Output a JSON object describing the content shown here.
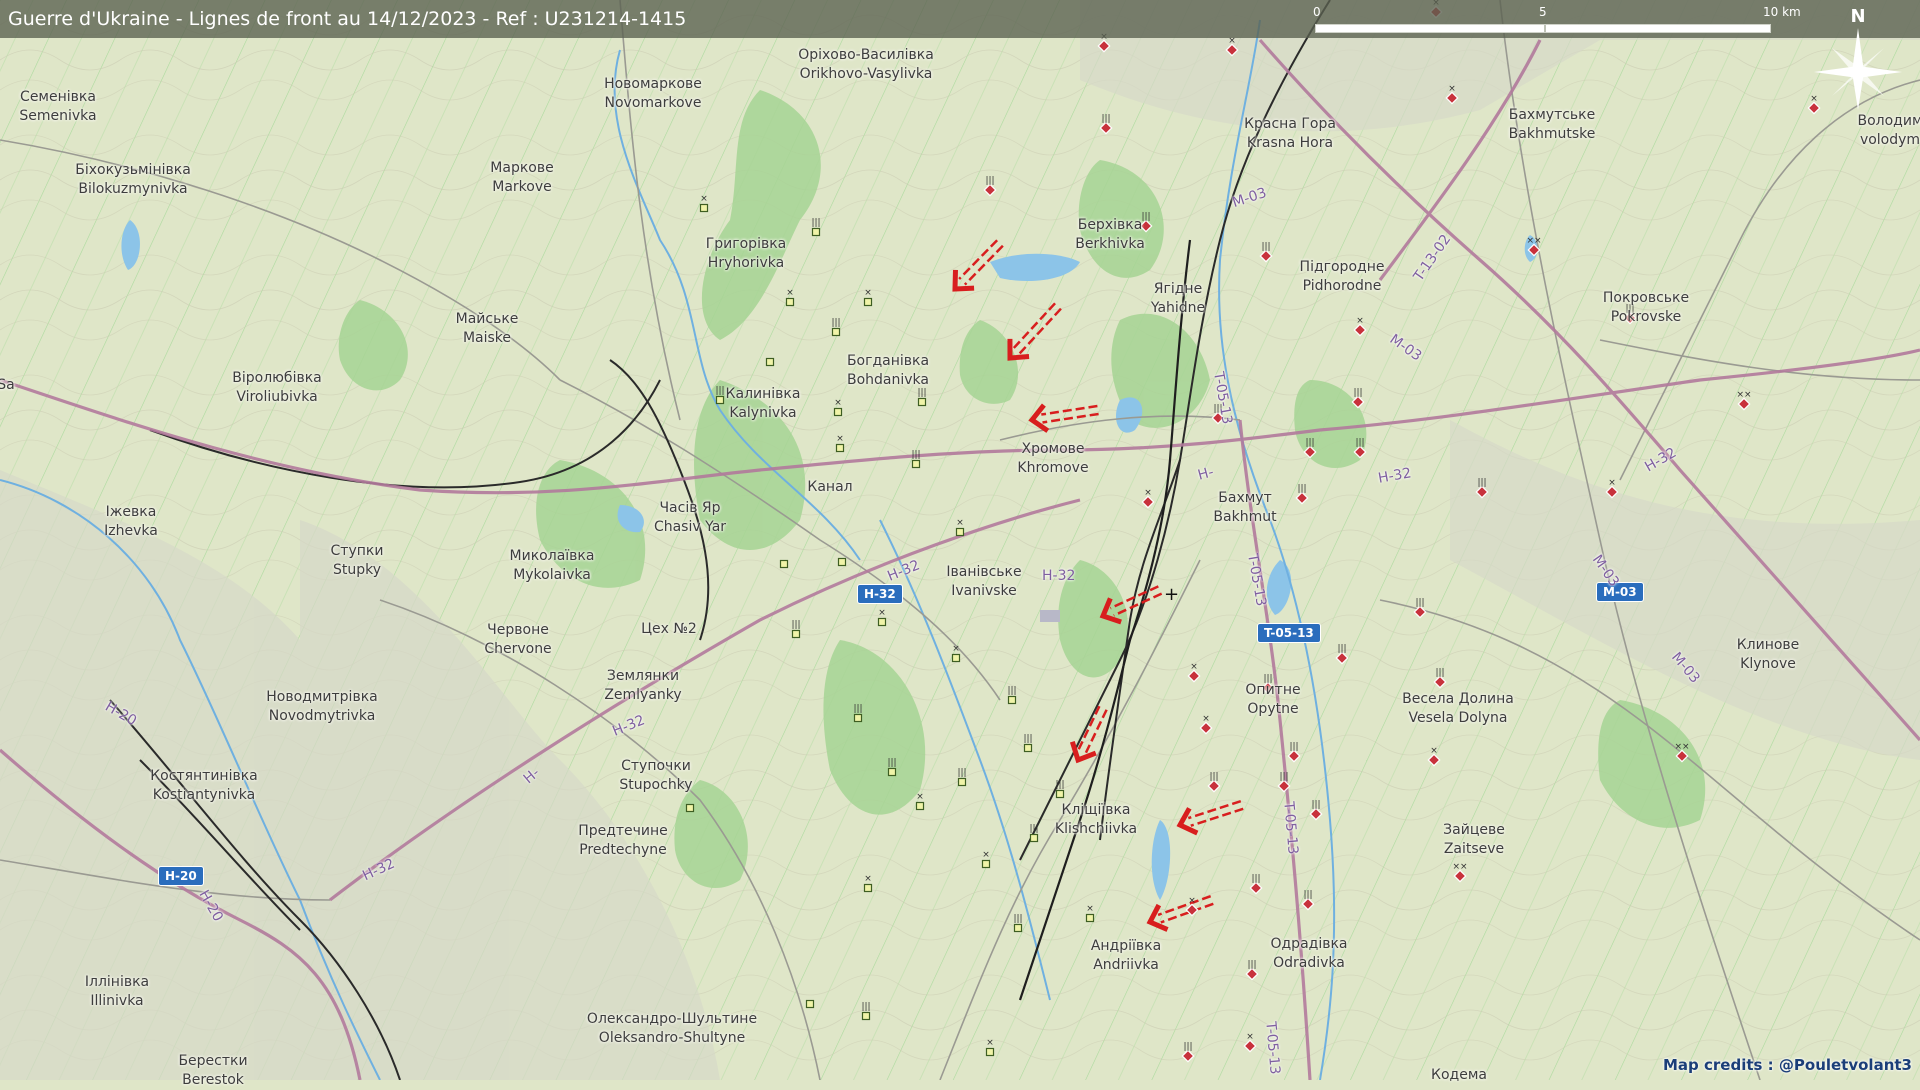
{
  "title": "Guerre d'Ukraine - Lignes de front au 14/12/2023 - Ref : U231214-1415",
  "scale": {
    "labels": [
      "0",
      "5",
      "10 km"
    ]
  },
  "north_label": "N",
  "credits": "Map credits : @Pouletvolant3",
  "colors": {
    "land": "#dfe6c8",
    "forest": "#9fcf8a",
    "water": "#8cc4e8",
    "road_main": "#b27a9c",
    "attack_arrow": "#d81e1e"
  },
  "places": [
    {
      "uk": "Семенівка",
      "en": "Semenivka"
    },
    {
      "uk": "Новомаркове",
      "en": "Novomarkove"
    },
    {
      "uk": "Оріхово-Василівка",
      "en": "Orikhovo-Vasylivka"
    },
    {
      "uk": "Красна Гора",
      "en": "Krasna Hora"
    },
    {
      "uk": "Бахмутське",
      "en": "Bakhmutske"
    },
    {
      "uk": "Володим",
      "en": "volodym"
    },
    {
      "uk": "Біхокузьмінівка",
      "en": "Bilokuzmynivka"
    },
    {
      "uk": "Маркове",
      "en": "Markove"
    },
    {
      "uk": "Григорівка",
      "en": "Hryhorivka"
    },
    {
      "uk": "Берхівка",
      "en": "Berkhivka"
    },
    {
      "uk": "Підгородне",
      "en": "Pidhorodne"
    },
    {
      "uk": "Покровське",
      "en": "Pokrovske"
    },
    {
      "uk": "Ягідне",
      "en": "Yahidne"
    },
    {
      "uk": "Майське",
      "en": "Maiske"
    },
    {
      "uk": "Богданівка",
      "en": "Bohdanivka"
    },
    {
      "uk": "Віролюбівка",
      "en": "Viroliubivka"
    },
    {
      "uk": "Калинівка",
      "en": "Kalynivka"
    },
    {
      "uk": "Хромове",
      "en": "Khromove"
    },
    {
      "uk": "",
      "en": "Канал"
    },
    {
      "uk": "Бахмут",
      "en": "Bakhmut"
    },
    {
      "uk": "Іжевка",
      "en": "Izhevka"
    },
    {
      "uk": "Часів Яр",
      "en": "Chasiv Yar"
    },
    {
      "uk": "Ступки",
      "en": "Stupky"
    },
    {
      "uk": "Миколаївка",
      "en": "Mykolaivka"
    },
    {
      "uk": "Іванівське",
      "en": "Ivanivske"
    },
    {
      "uk": "Червоне",
      "en": "Chervone"
    },
    {
      "uk": "",
      "en": "Цех №2"
    },
    {
      "uk": "Землянки",
      "en": "Zemlyanky"
    },
    {
      "uk": "Новодмитрівка",
      "en": "Novodmytrivka"
    },
    {
      "uk": "Опитне",
      "en": "Opytne"
    },
    {
      "uk": "Весела Долина",
      "en": "Vesela Dolyna"
    },
    {
      "uk": "Клинове",
      "en": "Klynove"
    },
    {
      "uk": "Костянтинівка",
      "en": "Kostiantynivka"
    },
    {
      "uk": "Ступочки",
      "en": "Stupochky"
    },
    {
      "uk": "Кліщіївка",
      "en": "Klishchiivka"
    },
    {
      "uk": "Предтечине",
      "en": "Predtechyne"
    },
    {
      "uk": "Зайцеве",
      "en": "Zaitseve"
    },
    {
      "uk": "Андріївка",
      "en": "Andriivka"
    },
    {
      "uk": "Одрадівка",
      "en": "Odradivka"
    },
    {
      "uk": "Іллінівка",
      "en": "Illinivka"
    },
    {
      "uk": "Олександро-Шультине",
      "en": "Oleksandro-Shultyne"
    },
    {
      "uk": "Берестки",
      "en": "Berestok"
    },
    {
      "uk": "Кодема",
      "en": ""
    },
    {
      "uk": "",
      "en": "Sa"
    }
  ],
  "road_shields": [
    "H-32",
    "T-05-13",
    "M-03",
    "H-20"
  ],
  "road_tags": [
    "M-03",
    "M-03",
    "M-03",
    "M-03",
    "T-13-02",
    "T-05-13",
    "T-05-13",
    "T-05-13",
    "T-05-13",
    "H-32",
    "H-32",
    "H-32",
    "H-32",
    "H-32",
    "H-20",
    "H-20",
    "H-32",
    "H-",
    "H-"
  ]
}
